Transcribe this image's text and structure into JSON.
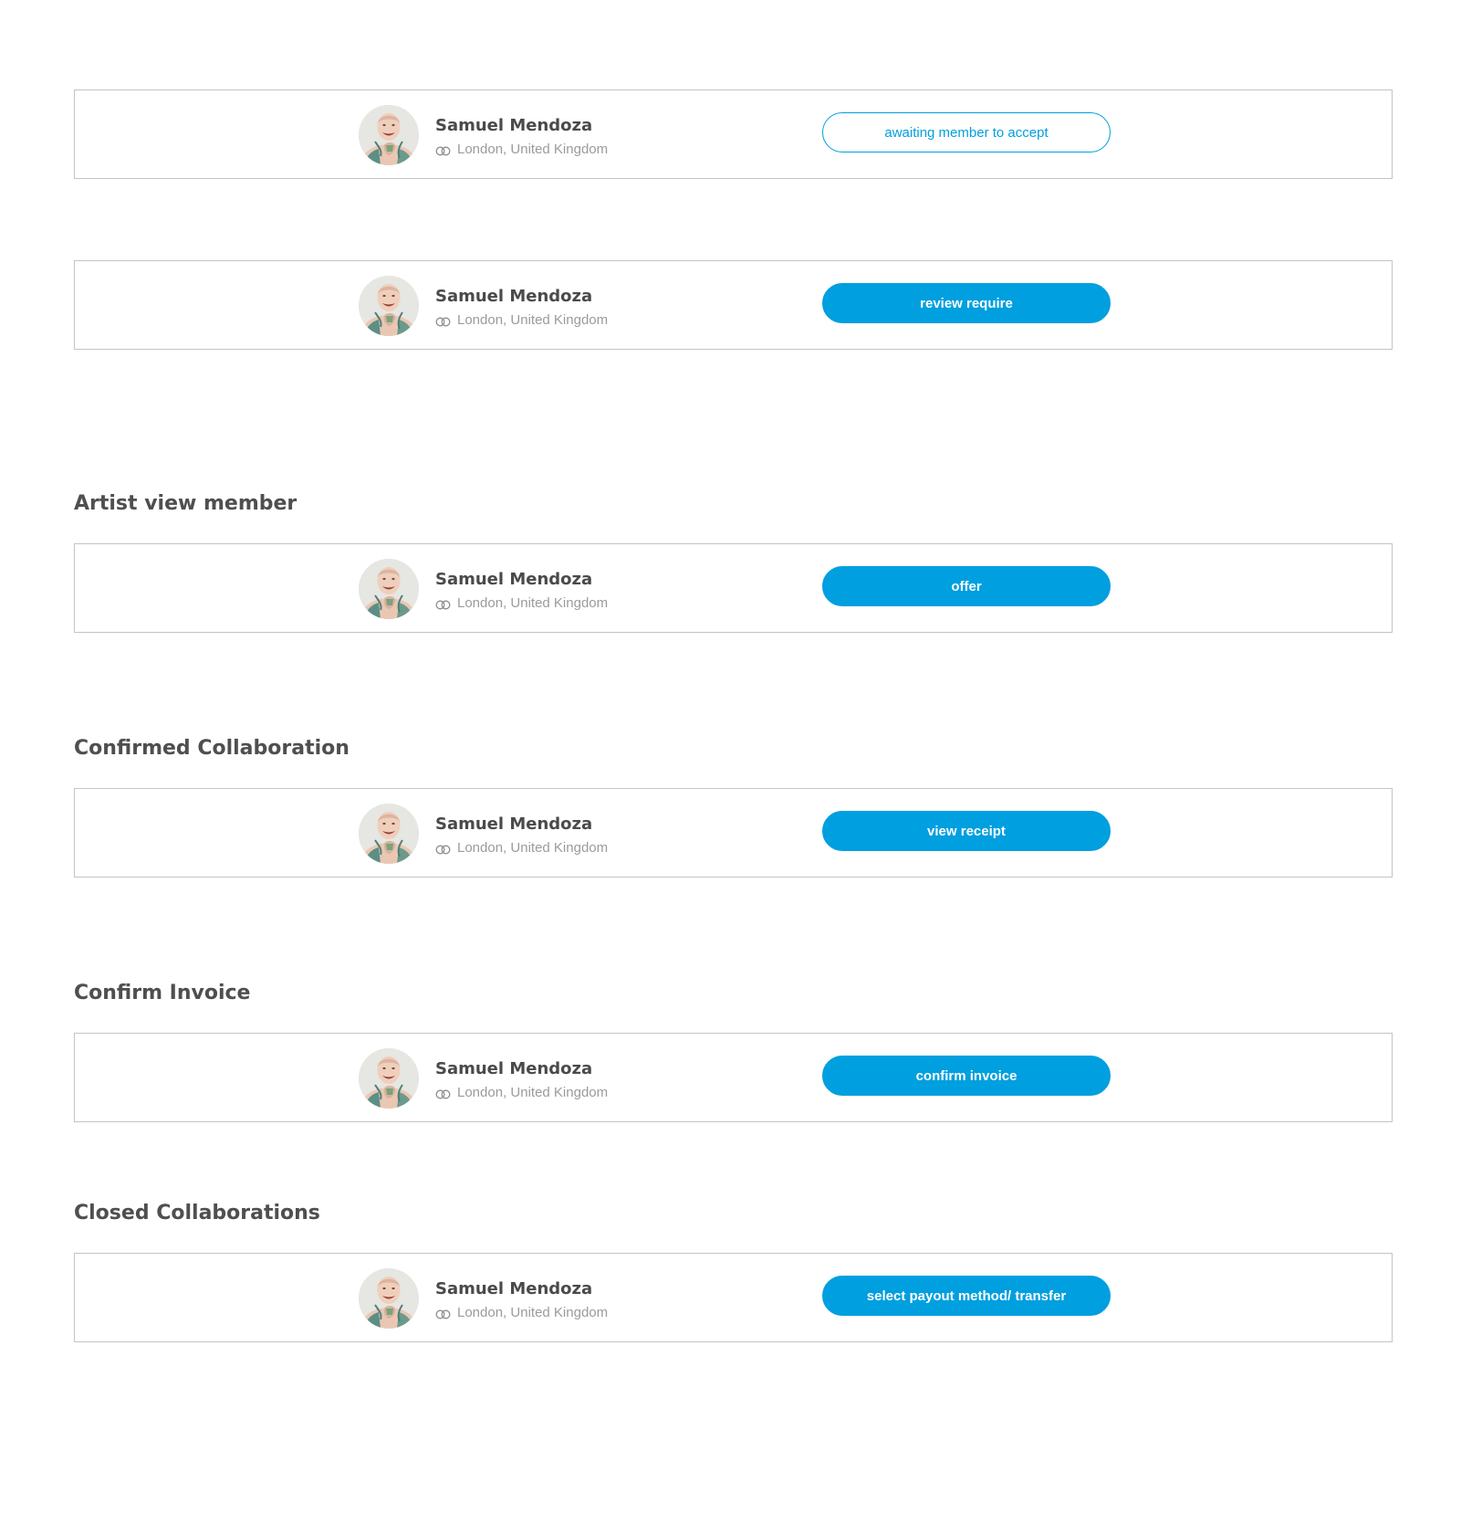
{
  "colors": {
    "accent": "#009fdf",
    "title": "#4f4f4f",
    "name": "#4a4a4a",
    "location": "#9b9b9b",
    "border": "#c4c4c4"
  },
  "sections": [
    {
      "title": ""
    },
    {
      "title": ""
    },
    {
      "title": "Artist view member"
    },
    {
      "title": "Confirmed Collaboration"
    },
    {
      "title": "Confirm Invoice"
    },
    {
      "title": "Closed Collaborations"
    }
  ],
  "cards": [
    {
      "name": "Samuel Mendoza",
      "location": "London, United Kingdom",
      "location_icon": "rings-icon",
      "button_label": "awaiting member to accept",
      "button_style": "outline"
    },
    {
      "name": "Samuel Mendoza",
      "location": "London, United Kingdom",
      "location_icon": "rings-icon",
      "button_label": "review require",
      "button_style": "filled"
    },
    {
      "name": "Samuel Mendoza",
      "location": "London, United Kingdom",
      "location_icon": "rings-icon",
      "button_label": "offer",
      "button_style": "filled"
    },
    {
      "name": "Samuel Mendoza",
      "location": "London, United Kingdom",
      "location_icon": "rings-icon",
      "button_label": "view receipt",
      "button_style": "filled"
    },
    {
      "name": "Samuel Mendoza",
      "location": "London, United Kingdom",
      "location_icon": "rings-icon",
      "button_label": "confirm invoice",
      "button_style": "filled"
    },
    {
      "name": "Samuel Mendoza",
      "location": "London, United Kingdom",
      "location_icon": "rings-icon",
      "button_label": "select payout method/ transfer",
      "button_style": "filled"
    }
  ]
}
